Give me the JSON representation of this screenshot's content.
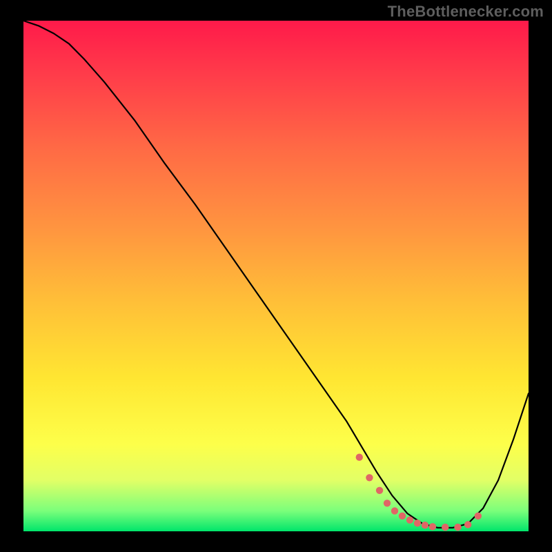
{
  "watermark": "TheBottlenecker.com",
  "colors": {
    "bg": "#000000",
    "curve": "#000000",
    "dots": "#e06666",
    "watermark_text": "#5e5e5e"
  },
  "chart_data": {
    "type": "line",
    "title": "",
    "xlabel": "",
    "ylabel": "",
    "xlim": [
      0,
      100
    ],
    "ylim": [
      0,
      100
    ],
    "gradient_stops": [
      {
        "offset": 0.0,
        "color": "#ff1a4a"
      },
      {
        "offset": 0.1,
        "color": "#ff3a4a"
      },
      {
        "offset": 0.25,
        "color": "#ff6a45"
      },
      {
        "offset": 0.4,
        "color": "#ff9340"
      },
      {
        "offset": 0.55,
        "color": "#ffbf38"
      },
      {
        "offset": 0.7,
        "color": "#ffe632"
      },
      {
        "offset": 0.83,
        "color": "#fdff4a"
      },
      {
        "offset": 0.9,
        "color": "#e2ff66"
      },
      {
        "offset": 0.96,
        "color": "#7bff7b"
      },
      {
        "offset": 1.0,
        "color": "#00e56b"
      }
    ],
    "series": [
      {
        "name": "bottleneck-curve",
        "x": [
          0.0,
          3.0,
          6.0,
          9.0,
          12.0,
          16.0,
          22.0,
          28.0,
          34.0,
          40.0,
          46.0,
          52.0,
          58.0,
          64.0,
          67.0,
          70.0,
          73.0,
          76.0,
          79.0,
          82.0,
          85.0,
          88.0,
          91.0,
          94.0,
          97.0,
          100.0
        ],
        "y": [
          100.0,
          99.0,
          97.5,
          95.5,
          92.5,
          88.0,
          80.5,
          72.0,
          64.0,
          55.5,
          47.0,
          38.5,
          30.0,
          21.5,
          16.5,
          11.5,
          7.0,
          3.5,
          1.5,
          0.7,
          0.7,
          1.5,
          4.5,
          10.0,
          18.0,
          27.0
        ]
      }
    ],
    "dot_band": {
      "name": "no-bottleneck-range",
      "x": [
        66.5,
        68.5,
        70.5,
        72.0,
        73.5,
        75.0,
        76.5,
        78.0,
        79.5,
        81.0,
        83.5,
        86.0,
        88.0,
        90.0
      ],
      "y": [
        14.5,
        10.5,
        8.0,
        5.5,
        4.0,
        3.0,
        2.2,
        1.6,
        1.2,
        0.9,
        0.8,
        0.8,
        1.3,
        3.0
      ]
    }
  }
}
